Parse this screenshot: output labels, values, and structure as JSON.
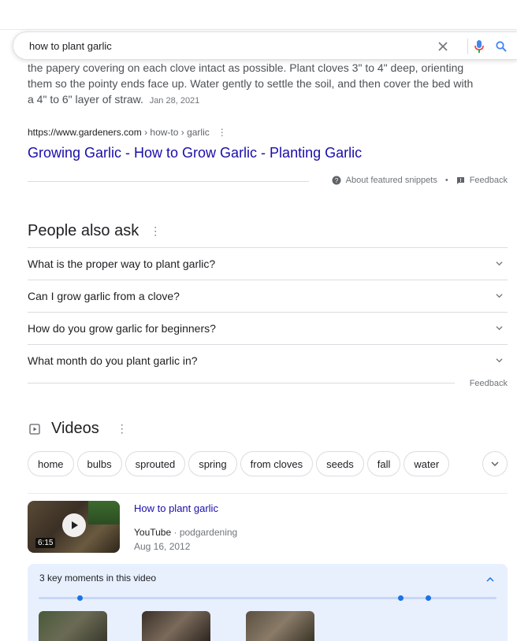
{
  "search": {
    "query": "how to plant garlic"
  },
  "icons": {
    "clear": "close-icon",
    "voice": "mic-icon",
    "search": "search-icon"
  },
  "colors": {
    "link": "#1a0dab",
    "mic_blue": "#4285f4",
    "mic_red": "#ea4335",
    "search_blue": "#4285f4",
    "moments_bg": "#e8f0fe"
  },
  "featured_snippet": {
    "text_line1": "the papery covering on each clove intact as possible. Plant cloves 3\" to 4\" deep, orienting",
    "text_line2": "them so the pointy ends face up. Water gently to settle the soil, and then cover the bed with",
    "text_line3": "a 4\" to 6\" layer of straw.",
    "date": "Jan 28, 2021",
    "domain": "https://www.gardeners.com",
    "path": " › how-to › garlic",
    "title": "Growing Garlic - How to Grow Garlic - Planting Garlic",
    "about_label": "About featured snippets",
    "separator": "•",
    "feedback_label": "Feedback"
  },
  "people_also_ask": {
    "heading": "People also ask",
    "questions": [
      "What is the proper way to plant garlic?",
      "Can I grow garlic from a clove?",
      "How do you grow garlic for beginners?",
      "What month do you plant garlic in?"
    ],
    "feedback_label": "Feedback"
  },
  "videos": {
    "heading": "Videos",
    "chips": [
      "home",
      "bulbs",
      "sprouted",
      "spring",
      "from cloves",
      "seeds",
      "fall",
      "water"
    ],
    "video": {
      "title": "How to plant garlic",
      "source": "YouTube",
      "channel": " · podgardening",
      "date": "Aug 16, 2012",
      "duration": "6:15"
    },
    "key_moments": {
      "label": "3 key moments in this video",
      "dot_positions_pct": [
        9,
        79,
        85
      ]
    }
  }
}
